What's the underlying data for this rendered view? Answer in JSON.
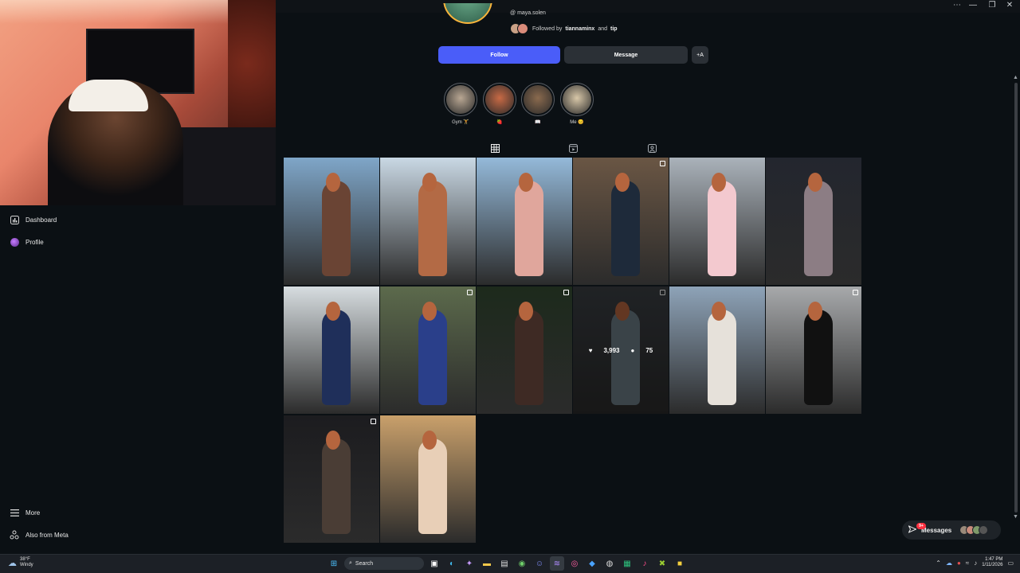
{
  "window": {
    "controls": [
      "⋯",
      "—",
      "❐",
      "✕"
    ]
  },
  "sidebar": {
    "items": [
      {
        "label": "Dashboard",
        "icon": "chart-icon"
      },
      {
        "label": "Profile",
        "icon": "avatar"
      }
    ],
    "bottom": [
      {
        "label": "More",
        "icon": "menu-icon"
      },
      {
        "label": "Also from Meta",
        "icon": "meta-icon"
      }
    ]
  },
  "profile": {
    "handle": "maya.solen",
    "followed_prefix": "Followed by",
    "followed_user1": "tiannaminx",
    "followed_and": "and",
    "followed_user2": "tip",
    "follow_label": "Follow",
    "message_label": "Message",
    "add_label": "+A"
  },
  "highlights": [
    {
      "label": "Gym 🏋️",
      "color": "#b9a793"
    },
    {
      "label": "🍓",
      "color": "#c86a45"
    },
    {
      "label": "📖",
      "color": "#8a6a4e"
    },
    {
      "label": "Me 😊",
      "color": "#d8c7a8"
    }
  ],
  "tabs": [
    "posts-grid-icon",
    "reels-icon",
    "tagged-icon"
  ],
  "posts": [
    {
      "bg": "#7fa6c8",
      "fig": "#6a4434"
    },
    {
      "bg": "#c9d8e4",
      "fig": "#b36a45"
    },
    {
      "bg": "#94b9d9",
      "fig": "#e0a69c"
    },
    {
      "bg": "#6a5644",
      "fig": "#1e2a3a",
      "multi": true
    },
    {
      "bg": "#aab2ba",
      "fig": "#f3c9cf"
    },
    {
      "bg": "#23262e",
      "fig": "#8c7d84"
    },
    {
      "bg": "#d7dde0",
      "fig": "#1f2f5a"
    },
    {
      "bg": "#5c6a4c",
      "fig": "#2a3f8a",
      "multi": true
    },
    {
      "bg": "#1d2a1c",
      "fig": "#3e2a24",
      "multi": true
    },
    {
      "bg": "#3b3f44",
      "fig": "#6a7a84",
      "multi": true,
      "likes": "3,993",
      "comments": "75"
    },
    {
      "bg": "#8ea3b8",
      "fig": "#e6e1da"
    },
    {
      "bg": "#a7a9ab",
      "fig": "#111111",
      "multi": true
    },
    {
      "bg": "#1c1c1f",
      "fig": "#4a3d35",
      "multi": true
    },
    {
      "bg": "#c9a06b",
      "fig": "#e8cfb7"
    }
  ],
  "messages": {
    "label": "Messages",
    "badge": "9+"
  },
  "taskbar": {
    "temp": "38°F",
    "condition": "Windy",
    "search_label": "Search",
    "time": "1:47 PM",
    "date": "1/11/2026"
  }
}
